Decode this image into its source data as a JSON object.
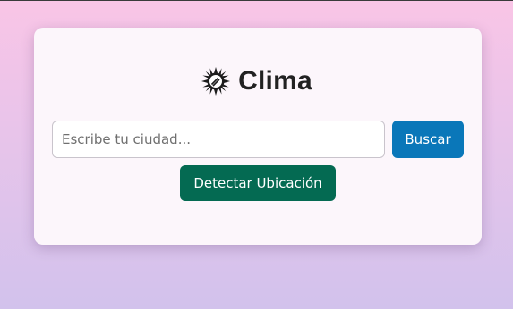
{
  "header": {
    "title": "Clima",
    "icon": "sun-icon"
  },
  "search": {
    "placeholder": "Escribe tu ciudad...",
    "value": ""
  },
  "buttons": {
    "search_label": "Buscar",
    "detect_label": "Detectar Ubicación"
  },
  "colors": {
    "search_button": "#0a77b9",
    "detect_button": "#046a52",
    "card_background": "#fcf6fb",
    "background_top": "#f9c5e6",
    "background_bottom": "#d2c2ec"
  }
}
